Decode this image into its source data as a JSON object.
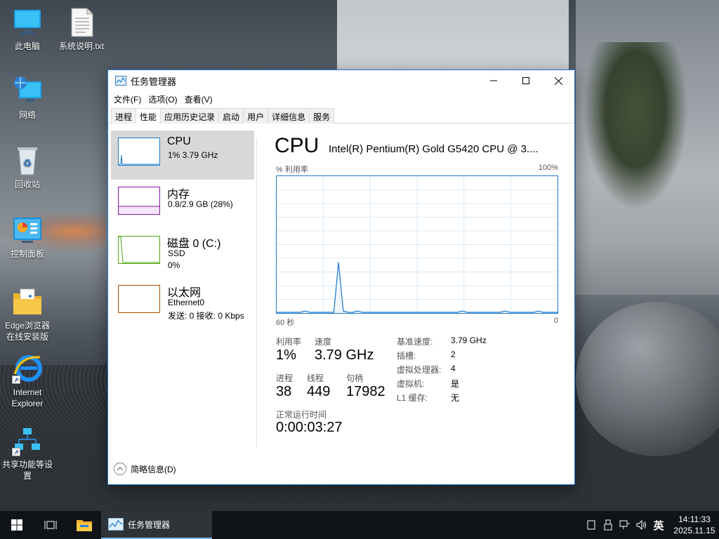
{
  "desktop": {
    "icons": [
      {
        "label": "此电脑",
        "icon": "computer-icon"
      },
      {
        "label": "系统说明.txt",
        "icon": "text-file-icon"
      },
      {
        "label": "网络",
        "icon": "network-icon"
      },
      {
        "label": "回收站",
        "icon": "recycle-bin-icon"
      },
      {
        "label": "控制面板",
        "icon": "control-panel-icon"
      },
      {
        "label": "Edge浏览器在线安装版",
        "icon": "edge-installer-icon"
      },
      {
        "label": "Internet Explorer",
        "icon": "ie-icon"
      },
      {
        "label": "共享功能等设置",
        "icon": "share-settings-icon"
      }
    ]
  },
  "window": {
    "title": "任务管理器",
    "menu": [
      "文件(F)",
      "选项(O)",
      "查看(V)"
    ],
    "tabs": [
      "进程",
      "性能",
      "应用历史记录",
      "启动",
      "用户",
      "详细信息",
      "服务"
    ],
    "active_tab": "性能"
  },
  "sidebar": {
    "items": [
      {
        "title": "CPU",
        "sub1": "1% 3.79 GHz",
        "sub2": "",
        "color": "#1979ca"
      },
      {
        "title": "内存",
        "sub1": "0.8/2.9 GB (28%)",
        "sub2": "",
        "color": "#8b12ae"
      },
      {
        "title": "磁盘 0 (C:)",
        "sub1": "SSD",
        "sub2": "0%",
        "color": "#4da60c"
      },
      {
        "title": "以太网",
        "sub1": "Ethernet0",
        "sub2": "发送: 0 接收: 0 Kbps",
        "color": "#a74f01"
      }
    ]
  },
  "cpu": {
    "heading": "CPU",
    "model": "Intel(R) Pentium(R) Gold G5420 CPU @ 3....",
    "graph_label_left": "% 利用率",
    "graph_label_right": "100%",
    "axis_left": "60 秒",
    "axis_right": "0",
    "usage_history_percent": [
      0,
      0,
      0,
      0,
      0,
      0,
      1,
      0,
      0,
      0,
      0,
      0,
      0,
      37,
      1,
      0,
      0,
      1,
      0,
      0,
      0,
      0,
      0,
      0,
      0,
      0,
      0,
      0,
      0,
      0,
      0,
      0,
      0,
      0,
      0,
      0,
      0,
      0,
      0,
      1,
      0,
      0,
      0,
      0,
      0,
      0,
      0,
      0,
      1,
      0,
      0,
      0,
      0,
      0,
      0,
      1,
      0,
      0,
      0,
      0
    ],
    "stats": {
      "util_label": "利用率",
      "util_value": "1%",
      "speed_label": "速度",
      "speed_value": "3.79 GHz",
      "proc_label": "进程",
      "proc_value": "38",
      "thread_label": "线程",
      "thread_value": "449",
      "handle_label": "句柄",
      "handle_value": "17982",
      "uptime_label": "正常运行时间",
      "uptime_value": "0:00:03:27"
    },
    "details": [
      {
        "k": "基准速度:",
        "v": "3.79 GHz"
      },
      {
        "k": "插槽:",
        "v": "2"
      },
      {
        "k": "虚拟处理器:",
        "v": "4"
      },
      {
        "k": "虚拟机:",
        "v": "是"
      },
      {
        "k": "L1 缓存:",
        "v": "无"
      }
    ]
  },
  "footer": {
    "label": "简略信息(D)"
  },
  "taskbar": {
    "app_label": "任务管理器",
    "ime": "英",
    "time": "14:11:33",
    "date": "2025.11.15"
  },
  "colors": {
    "accent": "#1979ca",
    "taskbar": "#101317"
  }
}
